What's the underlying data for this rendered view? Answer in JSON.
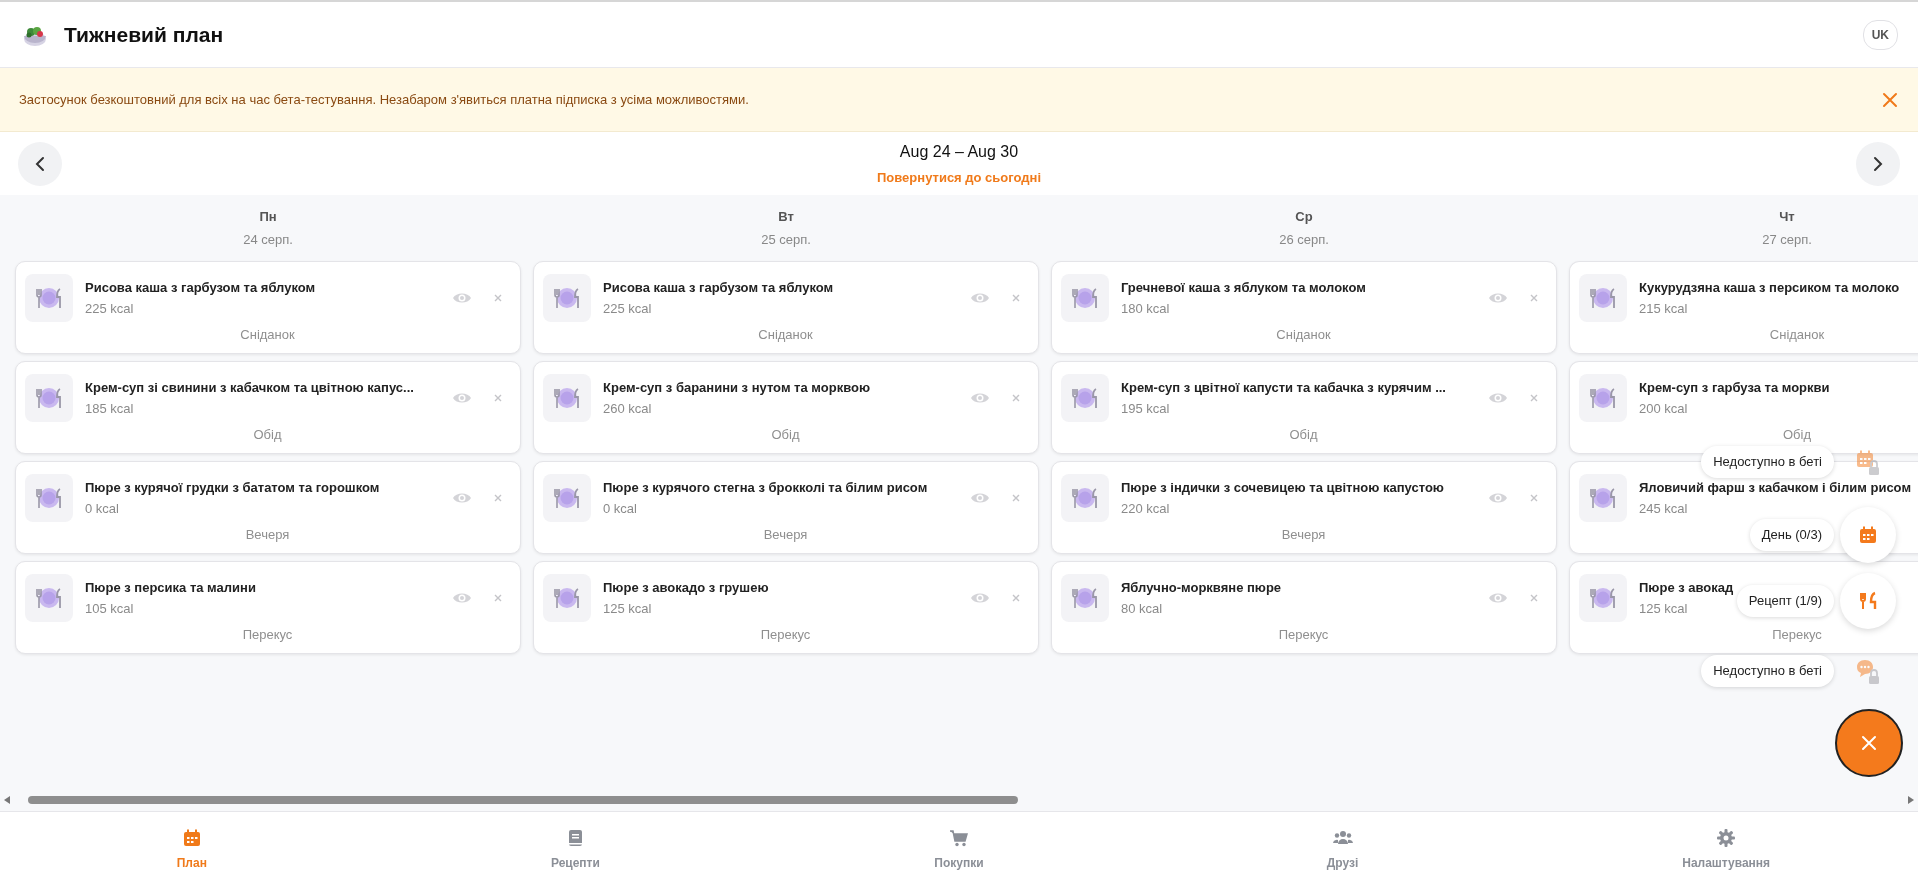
{
  "header": {
    "title": "Тижневий план",
    "language": "UK"
  },
  "banner": {
    "text": "Застосунок безкоштовний для всіх на час бета-тестування. Незабаром з'явиться платна підписка з усіма можливостями."
  },
  "week": {
    "range": "Aug 24 – Aug 30",
    "today_link": "Повернутися до сьогодні"
  },
  "days": [
    {
      "name": "Пн",
      "date": "24 серп.",
      "clipped": false,
      "meals": [
        {
          "dish": "Рисова каша з гарбузом та яблуком",
          "kcal": "225 kcal",
          "meal": "Сніданок"
        },
        {
          "dish": "Крем-суп зі свинини з кабачком та цвітною капус...",
          "kcal": "185 kcal",
          "meal": "Обід"
        },
        {
          "dish": "Пюре з курячої грудки з бататом та горошком",
          "kcal": "0 kcal",
          "meal": "Вечеря"
        },
        {
          "dish": "Пюре з персика та малини",
          "kcal": "105 kcal",
          "meal": "Перекус"
        }
      ]
    },
    {
      "name": "Вт",
      "date": "25 серп.",
      "clipped": false,
      "meals": [
        {
          "dish": "Рисова каша з гарбузом та яблуком",
          "kcal": "225 kcal",
          "meal": "Сніданок"
        },
        {
          "dish": "Крем-суп з баранини з нутом та морквою",
          "kcal": "260 kcal",
          "meal": "Обід"
        },
        {
          "dish": "Пюре з курячого стегна з брокколі та білим рисом",
          "kcal": "0 kcal",
          "meal": "Вечеря"
        },
        {
          "dish": "Пюре з авокадо з грушею",
          "kcal": "125 kcal",
          "meal": "Перекус"
        }
      ]
    },
    {
      "name": "Ср",
      "date": "26 серп.",
      "clipped": false,
      "meals": [
        {
          "dish": "Гречневої каша з яблуком та молоком",
          "kcal": "180 kcal",
          "meal": "Сніданок"
        },
        {
          "dish": "Крем-суп з цвітної капусти та кабачка з курячим ...",
          "kcal": "195 kcal",
          "meal": "Обід"
        },
        {
          "dish": "Пюре з індички з сочевицею та цвітною капустою",
          "kcal": "220 kcal",
          "meal": "Вечеря"
        },
        {
          "dish": "Яблучно-морквяне пюре",
          "kcal": "80 kcal",
          "meal": "Перекус"
        }
      ]
    },
    {
      "name": "Чт",
      "date": "27 серп.",
      "clipped": true,
      "meals": [
        {
          "dish": "Кукурудзяна каша з персиком та молоко",
          "kcal": "215 kcal",
          "meal": "Сніданок"
        },
        {
          "dish": "Крем-суп з гарбуза та моркви",
          "kcal": "200 kcal",
          "meal": "Обід"
        },
        {
          "dish": "Яловичий фарш з кабачком і білим рисом",
          "kcal": "245 kcal"
        },
        {
          "dish": "Пюре з авокад",
          "kcal": "125 kcal",
          "meal": "Перекус"
        }
      ]
    }
  ],
  "quick_menu": [
    {
      "label": "Недоступно в беті",
      "kind": "calendar",
      "locked": true
    },
    {
      "label": "День (0/3)",
      "kind": "calendar",
      "locked": false
    },
    {
      "label": "Рецепт (1/9)",
      "kind": "recipe",
      "locked": false
    },
    {
      "label": "Недоступно в беті",
      "kind": "chat",
      "locked": true
    }
  ],
  "bottom_nav": [
    {
      "label": "План",
      "kind": "calendar",
      "selected": true
    },
    {
      "label": "Рецепти",
      "kind": "book",
      "selected": false
    },
    {
      "label": "Покупки",
      "kind": "cart",
      "selected": false
    },
    {
      "label": "Друзі",
      "kind": "people",
      "selected": false
    },
    {
      "label": "Налаштування",
      "kind": "gear",
      "selected": false
    }
  ]
}
